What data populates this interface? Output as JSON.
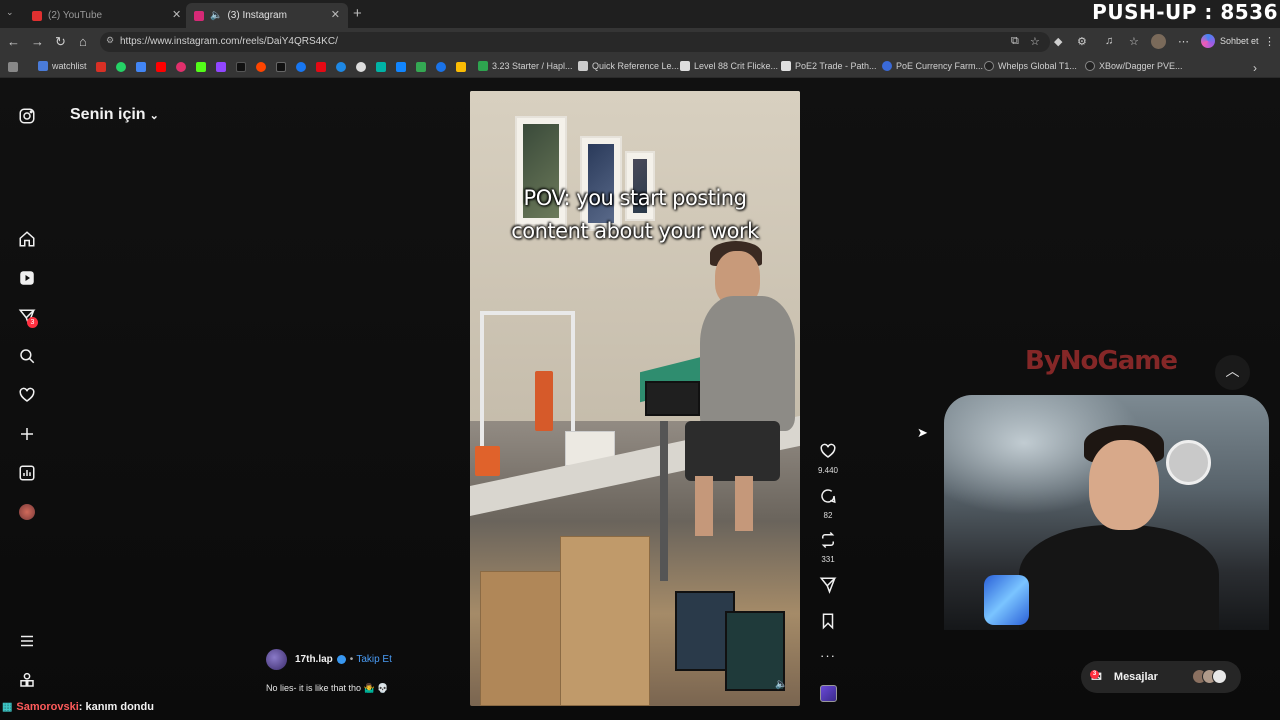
{
  "browser": {
    "tabs": [
      {
        "title": "(2) YouTube",
        "active": false,
        "favicon_color": "#e03030"
      },
      {
        "title": "(3) Instagram",
        "active": true,
        "favicon_color": "#d62976"
      }
    ],
    "url": "https://www.instagram.com/reels/DaiY4QRS4KC/",
    "bookmarks": [
      {
        "label": "watchlist",
        "color": "#4a7bd8"
      },
      {
        "label": "3.23 Starter / Hapl...",
        "color": "#2ea44f"
      },
      {
        "label": "Quick Reference Le...",
        "color": "#cccccc"
      },
      {
        "label": "Level 88 Crit Flicke...",
        "color": "#dddddd"
      },
      {
        "label": "PoE2 Trade - Path...",
        "color": "#e0e0e0"
      },
      {
        "label": "PoE Currency Farm...",
        "color": "#3a6ad8"
      },
      {
        "label": "Whelps Global T1...",
        "color": "#222222"
      },
      {
        "label": "XBow/Dagger PVE...",
        "color": "#222222"
      }
    ],
    "profile_button": "Sohbet et"
  },
  "overlay": {
    "pushup_counter": "PUSH-UP : 8536",
    "watermark": "ByNoGame",
    "chat_user": "Samorovski",
    "chat_message": ": kanım dondu"
  },
  "instagram": {
    "feed_title": "Senin için",
    "nav_badge_count": "3",
    "reel": {
      "caption_line1": "POV: you start posting",
      "caption_line2": "content about your work",
      "likes": "9.440",
      "comments": "82",
      "reposts": "331",
      "author": "17th.lap",
      "follow_label": "Takip Et",
      "description": "No lies- it is like that tho 🤷‍♂️ 💀"
    },
    "messages_label": "Mesajlar",
    "messages_badge": "3"
  }
}
